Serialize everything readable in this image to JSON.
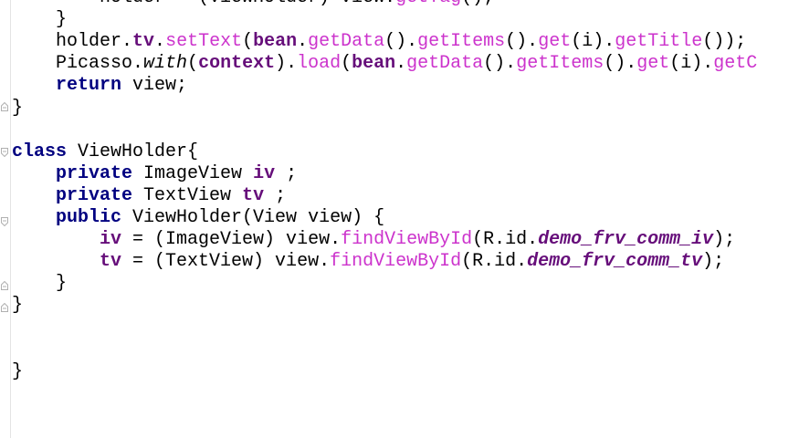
{
  "editor": {
    "lines": [
      {
        "indent": "        ",
        "tokens": [
          {
            "t": "holder = (ViewHolder) view.",
            "c": "plain"
          },
          {
            "t": "getTag",
            "c": "mth"
          },
          {
            "t": "();",
            "c": "plain"
          }
        ]
      },
      {
        "indent": "    ",
        "tokens": [
          {
            "t": "}",
            "c": "plain"
          }
        ]
      },
      {
        "indent": "    ",
        "tokens": [
          {
            "t": "holder.",
            "c": "plain"
          },
          {
            "t": "tv",
            "c": "fld"
          },
          {
            "t": ".",
            "c": "plain"
          },
          {
            "t": "setText",
            "c": "mth"
          },
          {
            "t": "(",
            "c": "plain"
          },
          {
            "t": "bean",
            "c": "fld"
          },
          {
            "t": ".",
            "c": "plain"
          },
          {
            "t": "getData",
            "c": "mth"
          },
          {
            "t": "().",
            "c": "plain"
          },
          {
            "t": "getItems",
            "c": "mth"
          },
          {
            "t": "().",
            "c": "plain"
          },
          {
            "t": "get",
            "c": "mth"
          },
          {
            "t": "(i).",
            "c": "plain"
          },
          {
            "t": "getTitle",
            "c": "mth"
          },
          {
            "t": "());",
            "c": "plain"
          }
        ]
      },
      {
        "indent": "    ",
        "tokens": [
          {
            "t": "Picasso.",
            "c": "plain"
          },
          {
            "t": "with",
            "c": "it"
          },
          {
            "t": "(",
            "c": "plain"
          },
          {
            "t": "context",
            "c": "fld"
          },
          {
            "t": ").",
            "c": "plain"
          },
          {
            "t": "load",
            "c": "mth"
          },
          {
            "t": "(",
            "c": "plain"
          },
          {
            "t": "bean",
            "c": "fld"
          },
          {
            "t": ".",
            "c": "plain"
          },
          {
            "t": "getData",
            "c": "mth"
          },
          {
            "t": "().",
            "c": "plain"
          },
          {
            "t": "getItems",
            "c": "mth"
          },
          {
            "t": "().",
            "c": "plain"
          },
          {
            "t": "get",
            "c": "mth"
          },
          {
            "t": "(i).",
            "c": "plain"
          },
          {
            "t": "getC",
            "c": "mth"
          }
        ]
      },
      {
        "indent": "    ",
        "tokens": [
          {
            "t": "return",
            "c": "kw"
          },
          {
            "t": " view;",
            "c": "plain"
          }
        ]
      },
      {
        "indent": "",
        "tokens": [
          {
            "t": "}",
            "c": "plain"
          }
        ]
      },
      {
        "indent": "",
        "tokens": []
      },
      {
        "indent": "",
        "tokens": [
          {
            "t": "class",
            "c": "kw"
          },
          {
            "t": " ViewHolder{",
            "c": "plain"
          }
        ]
      },
      {
        "indent": "    ",
        "tokens": [
          {
            "t": "private",
            "c": "kw"
          },
          {
            "t": " ImageView ",
            "c": "plain"
          },
          {
            "t": "iv",
            "c": "fld"
          },
          {
            "t": " ;",
            "c": "plain"
          }
        ]
      },
      {
        "indent": "    ",
        "tokens": [
          {
            "t": "private",
            "c": "kw"
          },
          {
            "t": " TextView ",
            "c": "plain"
          },
          {
            "t": "tv",
            "c": "fld"
          },
          {
            "t": " ;",
            "c": "plain"
          }
        ]
      },
      {
        "indent": "    ",
        "tokens": [
          {
            "t": "public",
            "c": "kw"
          },
          {
            "t": " ViewHolder(View view) {",
            "c": "plain"
          }
        ]
      },
      {
        "indent": "        ",
        "tokens": [
          {
            "t": "iv",
            "c": "fld"
          },
          {
            "t": " = (ImageView) view.",
            "c": "plain"
          },
          {
            "t": "findViewById",
            "c": "mth"
          },
          {
            "t": "(R.id.",
            "c": "plain"
          },
          {
            "t": "demo_frv_comm_iv",
            "c": "fldi"
          },
          {
            "t": ");",
            "c": "plain"
          }
        ]
      },
      {
        "indent": "        ",
        "tokens": [
          {
            "t": "tv",
            "c": "fld"
          },
          {
            "t": " = (TextView) view.",
            "c": "plain"
          },
          {
            "t": "findViewById",
            "c": "mth"
          },
          {
            "t": "(R.id.",
            "c": "plain"
          },
          {
            "t": "demo_frv_comm_tv",
            "c": "fldi"
          },
          {
            "t": ");",
            "c": "plain"
          }
        ]
      },
      {
        "indent": "    ",
        "tokens": [
          {
            "t": "}",
            "c": "plain"
          }
        ]
      },
      {
        "indent": "",
        "tokens": [
          {
            "t": "}",
            "c": "plain"
          }
        ]
      },
      {
        "indent": "",
        "tokens": []
      },
      {
        "indent": "",
        "tokens": []
      },
      {
        "indent": "",
        "tokens": [
          {
            "t": "}",
            "c": "plain"
          }
        ]
      }
    ]
  },
  "colors": {
    "background": "#ffffff",
    "keyword": "#000080",
    "field": "#660e7a",
    "method_call": "#cc33cc",
    "plain": "#000000"
  }
}
